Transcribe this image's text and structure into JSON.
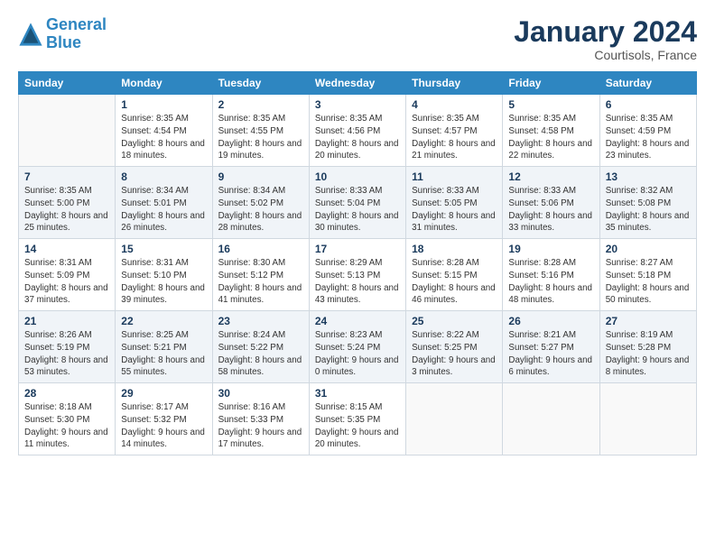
{
  "logo": {
    "line1": "General",
    "line2": "Blue"
  },
  "title": "January 2024",
  "location": "Courtisols, France",
  "days_of_week": [
    "Sunday",
    "Monday",
    "Tuesday",
    "Wednesday",
    "Thursday",
    "Friday",
    "Saturday"
  ],
  "weeks": [
    [
      {
        "day": "",
        "sunrise": "",
        "sunset": "",
        "daylight": ""
      },
      {
        "day": "1",
        "sunrise": "Sunrise: 8:35 AM",
        "sunset": "Sunset: 4:54 PM",
        "daylight": "Daylight: 8 hours and 18 minutes."
      },
      {
        "day": "2",
        "sunrise": "Sunrise: 8:35 AM",
        "sunset": "Sunset: 4:55 PM",
        "daylight": "Daylight: 8 hours and 19 minutes."
      },
      {
        "day": "3",
        "sunrise": "Sunrise: 8:35 AM",
        "sunset": "Sunset: 4:56 PM",
        "daylight": "Daylight: 8 hours and 20 minutes."
      },
      {
        "day": "4",
        "sunrise": "Sunrise: 8:35 AM",
        "sunset": "Sunset: 4:57 PM",
        "daylight": "Daylight: 8 hours and 21 minutes."
      },
      {
        "day": "5",
        "sunrise": "Sunrise: 8:35 AM",
        "sunset": "Sunset: 4:58 PM",
        "daylight": "Daylight: 8 hours and 22 minutes."
      },
      {
        "day": "6",
        "sunrise": "Sunrise: 8:35 AM",
        "sunset": "Sunset: 4:59 PM",
        "daylight": "Daylight: 8 hours and 23 minutes."
      }
    ],
    [
      {
        "day": "7",
        "sunrise": "Sunrise: 8:35 AM",
        "sunset": "Sunset: 5:00 PM",
        "daylight": "Daylight: 8 hours and 25 minutes."
      },
      {
        "day": "8",
        "sunrise": "Sunrise: 8:34 AM",
        "sunset": "Sunset: 5:01 PM",
        "daylight": "Daylight: 8 hours and 26 minutes."
      },
      {
        "day": "9",
        "sunrise": "Sunrise: 8:34 AM",
        "sunset": "Sunset: 5:02 PM",
        "daylight": "Daylight: 8 hours and 28 minutes."
      },
      {
        "day": "10",
        "sunrise": "Sunrise: 8:33 AM",
        "sunset": "Sunset: 5:04 PM",
        "daylight": "Daylight: 8 hours and 30 minutes."
      },
      {
        "day": "11",
        "sunrise": "Sunrise: 8:33 AM",
        "sunset": "Sunset: 5:05 PM",
        "daylight": "Daylight: 8 hours and 31 minutes."
      },
      {
        "day": "12",
        "sunrise": "Sunrise: 8:33 AM",
        "sunset": "Sunset: 5:06 PM",
        "daylight": "Daylight: 8 hours and 33 minutes."
      },
      {
        "day": "13",
        "sunrise": "Sunrise: 8:32 AM",
        "sunset": "Sunset: 5:08 PM",
        "daylight": "Daylight: 8 hours and 35 minutes."
      }
    ],
    [
      {
        "day": "14",
        "sunrise": "Sunrise: 8:31 AM",
        "sunset": "Sunset: 5:09 PM",
        "daylight": "Daylight: 8 hours and 37 minutes."
      },
      {
        "day": "15",
        "sunrise": "Sunrise: 8:31 AM",
        "sunset": "Sunset: 5:10 PM",
        "daylight": "Daylight: 8 hours and 39 minutes."
      },
      {
        "day": "16",
        "sunrise": "Sunrise: 8:30 AM",
        "sunset": "Sunset: 5:12 PM",
        "daylight": "Daylight: 8 hours and 41 minutes."
      },
      {
        "day": "17",
        "sunrise": "Sunrise: 8:29 AM",
        "sunset": "Sunset: 5:13 PM",
        "daylight": "Daylight: 8 hours and 43 minutes."
      },
      {
        "day": "18",
        "sunrise": "Sunrise: 8:28 AM",
        "sunset": "Sunset: 5:15 PM",
        "daylight": "Daylight: 8 hours and 46 minutes."
      },
      {
        "day": "19",
        "sunrise": "Sunrise: 8:28 AM",
        "sunset": "Sunset: 5:16 PM",
        "daylight": "Daylight: 8 hours and 48 minutes."
      },
      {
        "day": "20",
        "sunrise": "Sunrise: 8:27 AM",
        "sunset": "Sunset: 5:18 PM",
        "daylight": "Daylight: 8 hours and 50 minutes."
      }
    ],
    [
      {
        "day": "21",
        "sunrise": "Sunrise: 8:26 AM",
        "sunset": "Sunset: 5:19 PM",
        "daylight": "Daylight: 8 hours and 53 minutes."
      },
      {
        "day": "22",
        "sunrise": "Sunrise: 8:25 AM",
        "sunset": "Sunset: 5:21 PM",
        "daylight": "Daylight: 8 hours and 55 minutes."
      },
      {
        "day": "23",
        "sunrise": "Sunrise: 8:24 AM",
        "sunset": "Sunset: 5:22 PM",
        "daylight": "Daylight: 8 hours and 58 minutes."
      },
      {
        "day": "24",
        "sunrise": "Sunrise: 8:23 AM",
        "sunset": "Sunset: 5:24 PM",
        "daylight": "Daylight: 9 hours and 0 minutes."
      },
      {
        "day": "25",
        "sunrise": "Sunrise: 8:22 AM",
        "sunset": "Sunset: 5:25 PM",
        "daylight": "Daylight: 9 hours and 3 minutes."
      },
      {
        "day": "26",
        "sunrise": "Sunrise: 8:21 AM",
        "sunset": "Sunset: 5:27 PM",
        "daylight": "Daylight: 9 hours and 6 minutes."
      },
      {
        "day": "27",
        "sunrise": "Sunrise: 8:19 AM",
        "sunset": "Sunset: 5:28 PM",
        "daylight": "Daylight: 9 hours and 8 minutes."
      }
    ],
    [
      {
        "day": "28",
        "sunrise": "Sunrise: 8:18 AM",
        "sunset": "Sunset: 5:30 PM",
        "daylight": "Daylight: 9 hours and 11 minutes."
      },
      {
        "day": "29",
        "sunrise": "Sunrise: 8:17 AM",
        "sunset": "Sunset: 5:32 PM",
        "daylight": "Daylight: 9 hours and 14 minutes."
      },
      {
        "day": "30",
        "sunrise": "Sunrise: 8:16 AM",
        "sunset": "Sunset: 5:33 PM",
        "daylight": "Daylight: 9 hours and 17 minutes."
      },
      {
        "day": "31",
        "sunrise": "Sunrise: 8:15 AM",
        "sunset": "Sunset: 5:35 PM",
        "daylight": "Daylight: 9 hours and 20 minutes."
      },
      {
        "day": "",
        "sunrise": "",
        "sunset": "",
        "daylight": ""
      },
      {
        "day": "",
        "sunrise": "",
        "sunset": "",
        "daylight": ""
      },
      {
        "day": "",
        "sunrise": "",
        "sunset": "",
        "daylight": ""
      }
    ]
  ]
}
